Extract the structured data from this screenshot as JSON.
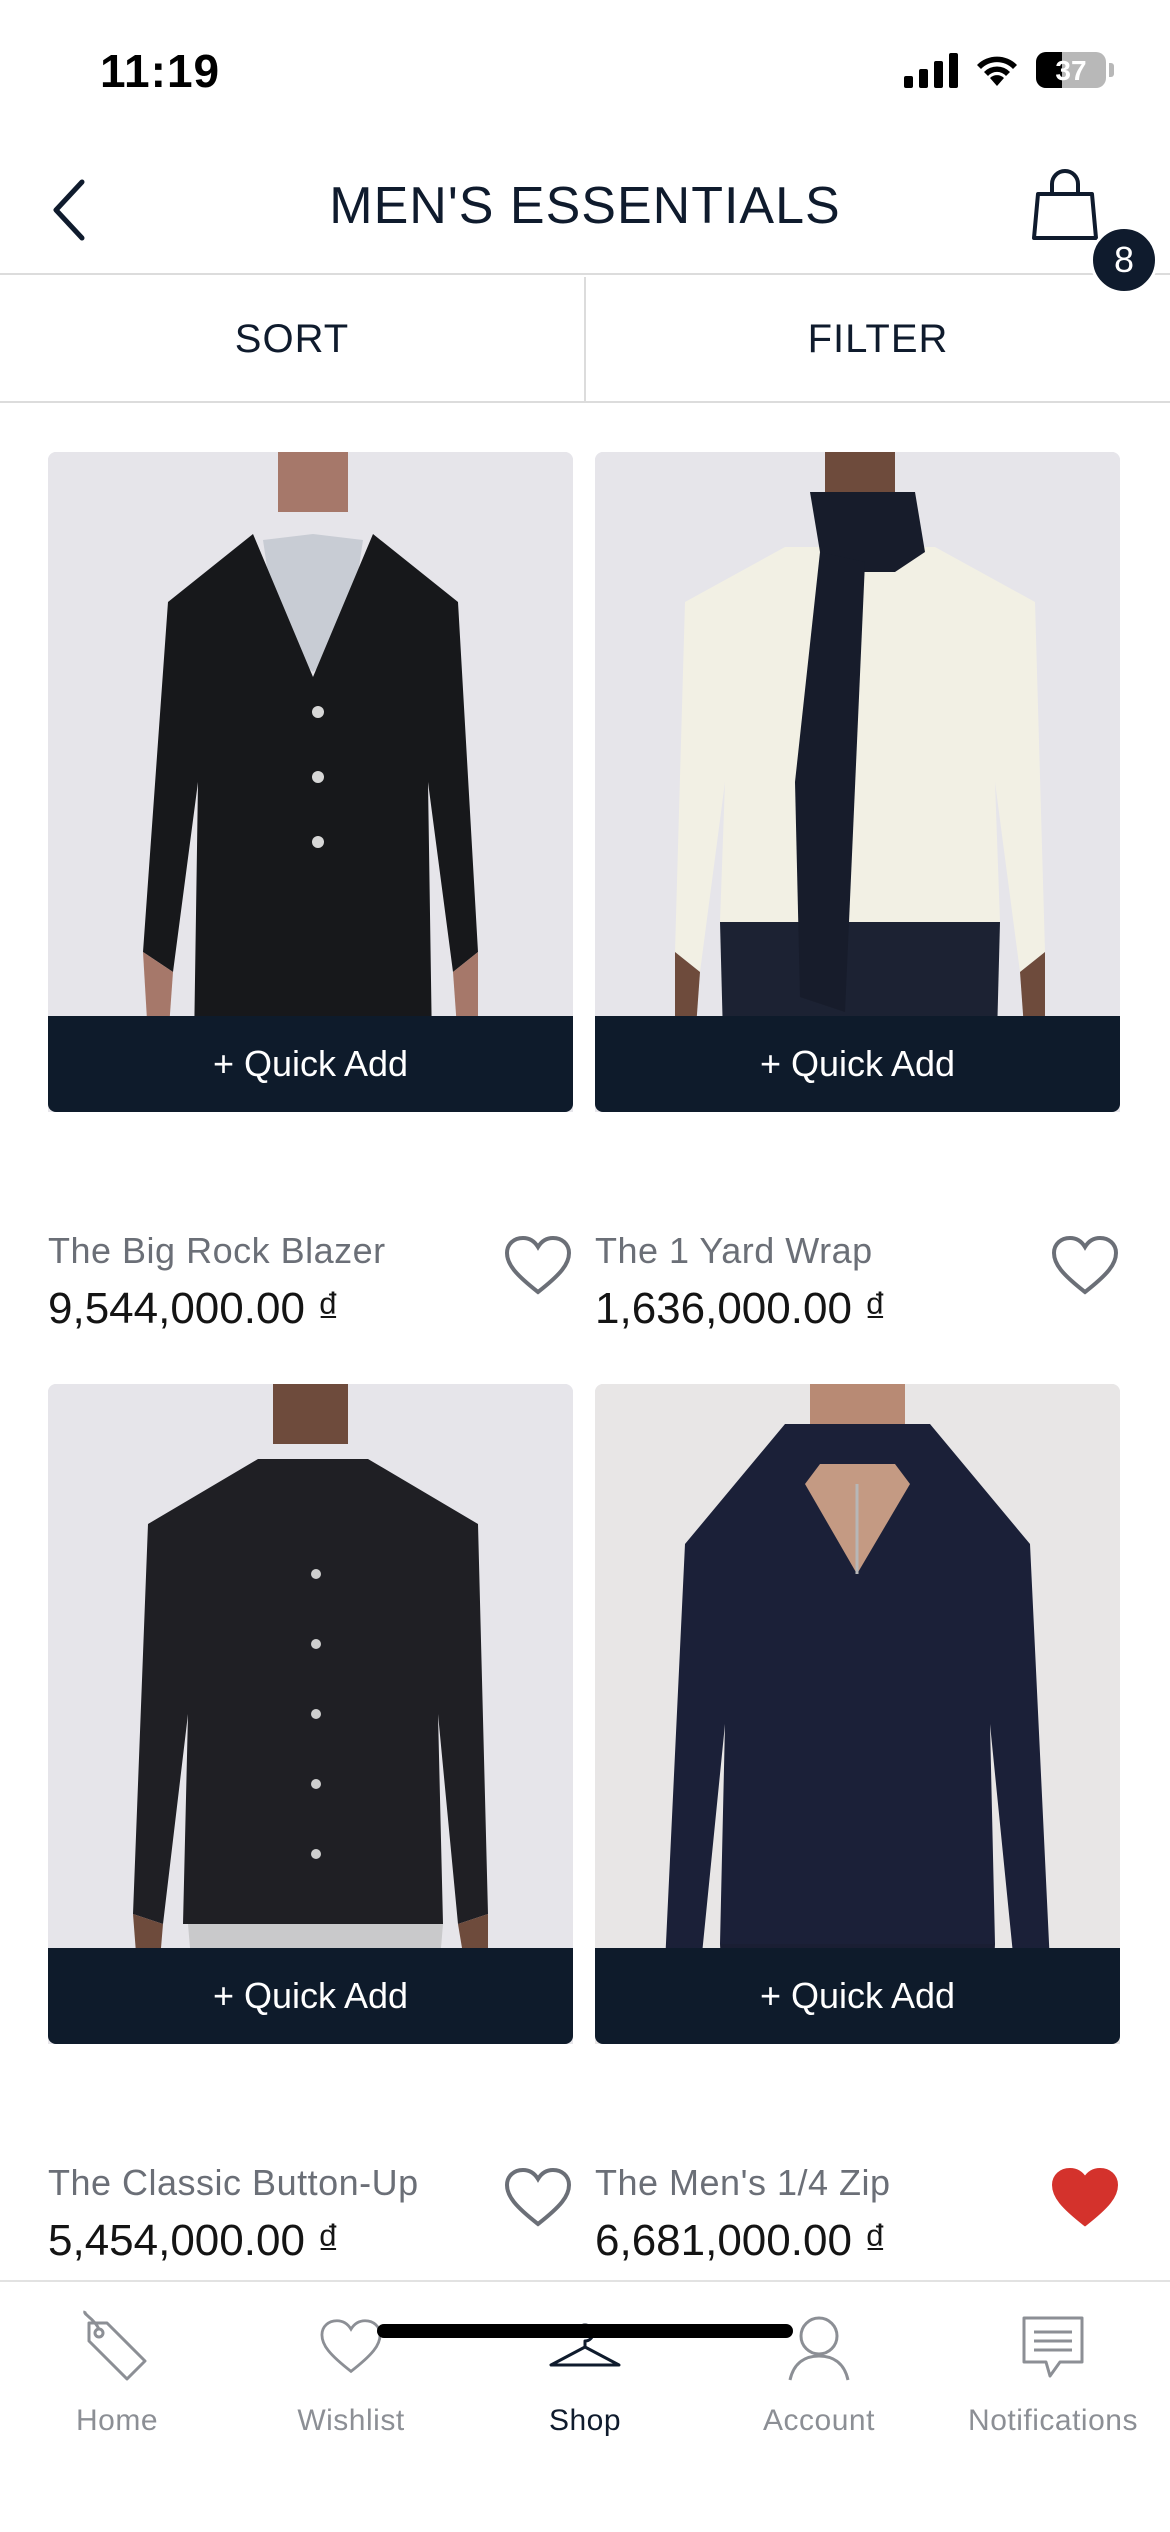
{
  "status_bar": {
    "time": "11:19",
    "battery_level": "37",
    "battery_percent": 37
  },
  "header": {
    "title": "MEN'S ESSENTIALS",
    "cart_count": "8"
  },
  "toolbar": {
    "sort_label": "SORT",
    "filter_label": "FILTER"
  },
  "products": [
    {
      "name": "The Big Rock Blazer",
      "price": "9,544,000.00 ₫",
      "quick_add": "+ Quick Add",
      "wishlisted": false
    },
    {
      "name": "The 1 Yard Wrap",
      "price": "1,636,000.00 ₫",
      "quick_add": "+ Quick Add",
      "wishlisted": false
    },
    {
      "name": "The Classic Button-Up",
      "price": "5,454,000.00 ₫",
      "quick_add": "+ Quick Add",
      "wishlisted": false
    },
    {
      "name": "The Men's 1/4 Zip",
      "price": "6,681,000.00 ₫",
      "quick_add": "+ Quick Add",
      "wishlisted": true
    }
  ],
  "bottom_nav": {
    "items": [
      {
        "label": "Home",
        "icon": "tag-icon"
      },
      {
        "label": "Wishlist",
        "icon": "heart-icon"
      },
      {
        "label": "Shop",
        "icon": "hanger-icon",
        "active": true
      },
      {
        "label": "Account",
        "icon": "person-icon"
      },
      {
        "label": "Notifications",
        "icon": "chat-icon"
      }
    ]
  },
  "colors": {
    "brand_navy": "#0e1b2b",
    "wishlist_red": "#d4322c",
    "muted_text": "#6b6f77"
  }
}
